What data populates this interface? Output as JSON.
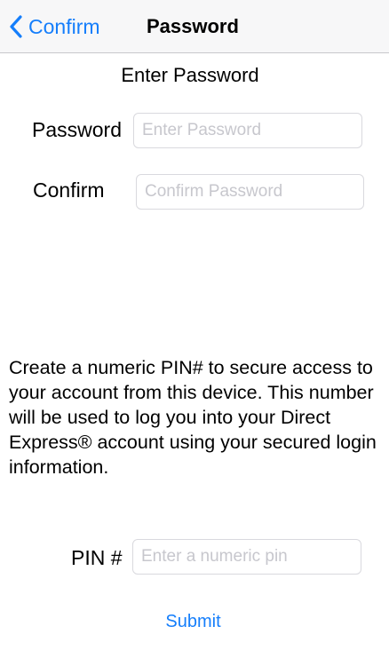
{
  "navbar": {
    "back_label": "Confirm",
    "title": "Password",
    "back_icon": "chevron-left-icon"
  },
  "form": {
    "heading": "Enter Password",
    "password_label": "Password",
    "password_placeholder": "Enter Password",
    "password_value": "",
    "confirm_label": "Confirm",
    "confirm_placeholder": "Confirm Password",
    "confirm_value": "",
    "info_text": "Create a numeric PIN# to secure access to your account from this device. This number will be used to log you into your Direct Express® account using your secured login information.",
    "pin_label": "PIN #",
    "pin_placeholder": "Enter a numeric pin",
    "pin_value": "",
    "submit_label": "Submit"
  },
  "colors": {
    "accent": "#157efb",
    "navbar_background": "#f7f7f8",
    "field_border": "#d9d9de",
    "placeholder": "#c7c7cd"
  }
}
